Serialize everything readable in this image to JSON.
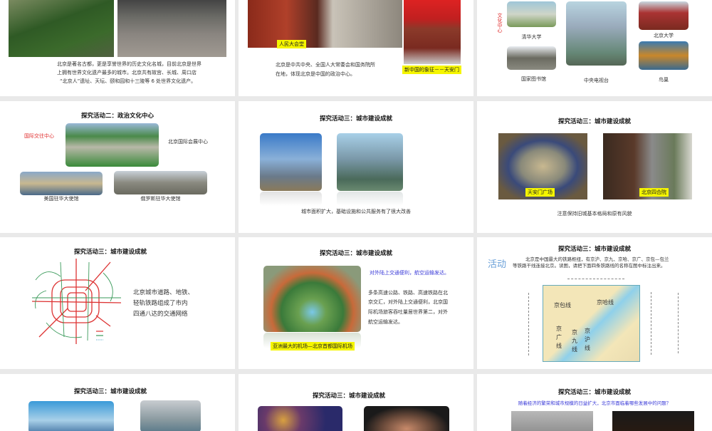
{
  "slides": {
    "s1": {
      "text": [
        "北京是著名古都，更是享誉世界的历史文化名城，目前北京是世界",
        "上拥有世界文化遗产最多的城市。北京共有故宫、长城、周口店",
        "“北京人”遗址、天坛、颐和园和十三陵等 6 处世界文化遗产。"
      ]
    },
    "s2": {
      "label1": "人民大会堂",
      "label2": "新中国的象征－－天安门",
      "text": [
        "北京是中共中央、全国人大常委会和国务院所",
        "在地，体现北京是中国的政治中心。"
      ]
    },
    "s3": {
      "side": "文化中心",
      "caps": [
        "清华大学",
        "国家图书馆",
        "中央电视台",
        "北京大学",
        "鸟巢"
      ]
    },
    "s4": {
      "title": "探究活动二：政治文化中心",
      "red": "国际交往中心",
      "center": "北京国际会展中心",
      "caps": [
        "美国驻华大使馆",
        "俄罗斯驻华大使馆"
      ]
    },
    "s5": {
      "title": "探究活动三：城市建设成就",
      "caption": "城市面积扩大，基础设施和公共服务有了很大改善"
    },
    "s6": {
      "title": "探究活动三：城市建设成就",
      "label1": "天安门广场",
      "label2": "北京四合院",
      "caption": "注意保持旧城基本格局和原有风貌"
    },
    "s7": {
      "title": "探究活动三：城市建设成就",
      "text": [
        "北京城市道路、地铁、",
        "轻轨铁路组成了市内",
        "四通八达的交通网络"
      ]
    },
    "s8": {
      "title": "探究活动三：城市建设成就",
      "blue": "对外陆上交通便利，航空运输发达。",
      "body": [
        "多条高速公路、铁路、高速铁路在北",
        "京交汇，对外陆上交通便利，北京国",
        "际机场旅客吞吐量居世界第二，对外",
        "航空运输发达。"
      ],
      "caption": "亚洲最大的机场—北京首都国际机场"
    },
    "s9": {
      "title": "探究活动三：城市建设成就",
      "tag": "活动",
      "text": [
        "北京是中国最大的铁路枢纽，有京沪、京九、京哈、京广、京包—包兰",
        "等铁路干线连接北京。读图，请把下面四条铁路线的名称在图中标注出来。"
      ],
      "map_labels": [
        "京包线",
        "京哈线",
        "京广线",
        "京九线",
        "京沪线"
      ]
    },
    "s10": {
      "title": "探究活动三：城市建设成就"
    },
    "s11": {
      "title": "探究活动三：城市建设成就"
    },
    "s12": {
      "title": "探究活动三：城市建设成就",
      "question": "随着经济的繁荣和城市规模的日益扩大，北京市面临着哪些发展中的问题？"
    }
  },
  "colors": {
    "accent_yellow": "#f5f500",
    "red": "#e03030",
    "blue": "#3a3ad8"
  }
}
